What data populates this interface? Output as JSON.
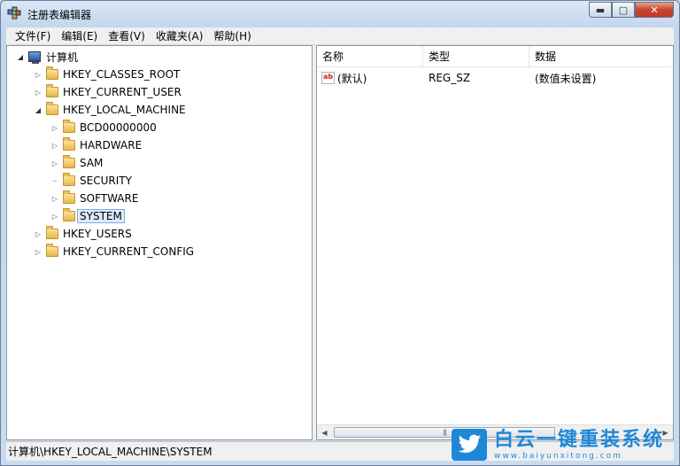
{
  "window": {
    "title": "注册表编辑器"
  },
  "controls": {
    "minimize": "▬",
    "maximize": "▢",
    "close": "✕"
  },
  "menu": [
    "文件(F)",
    "编辑(E)",
    "查看(V)",
    "收藏夹(A)",
    "帮助(H)"
  ],
  "tree": {
    "root": "计算机",
    "hkcr": "HKEY_CLASSES_ROOT",
    "hkcu": "HKEY_CURRENT_USER",
    "hklm": "HKEY_LOCAL_MACHINE",
    "hklm_children": [
      "BCD00000000",
      "HARDWARE",
      "SAM",
      "SECURITY",
      "SOFTWARE",
      "SYSTEM"
    ],
    "hku": "HKEY_USERS",
    "hkcc": "HKEY_CURRENT_CONFIG",
    "selected": "SYSTEM"
  },
  "list": {
    "columns": [
      "名称",
      "类型",
      "数据"
    ],
    "rows": [
      {
        "name": "(默认)",
        "type": "REG_SZ",
        "data": "(数值未设置)",
        "icon": "ab-string-icon"
      }
    ]
  },
  "status": {
    "path": "计算机\\HKEY_LOCAL_MACHINE\\SYSTEM"
  },
  "watermark": {
    "title": "白云一键重装系统",
    "url": "www.baiyunxitong.com",
    "logo": "twitter-bird-icon"
  },
  "colors": {
    "brand": "#1e88d8",
    "selection_border": "#84acdd",
    "selection_bg": "#dcebfc"
  }
}
